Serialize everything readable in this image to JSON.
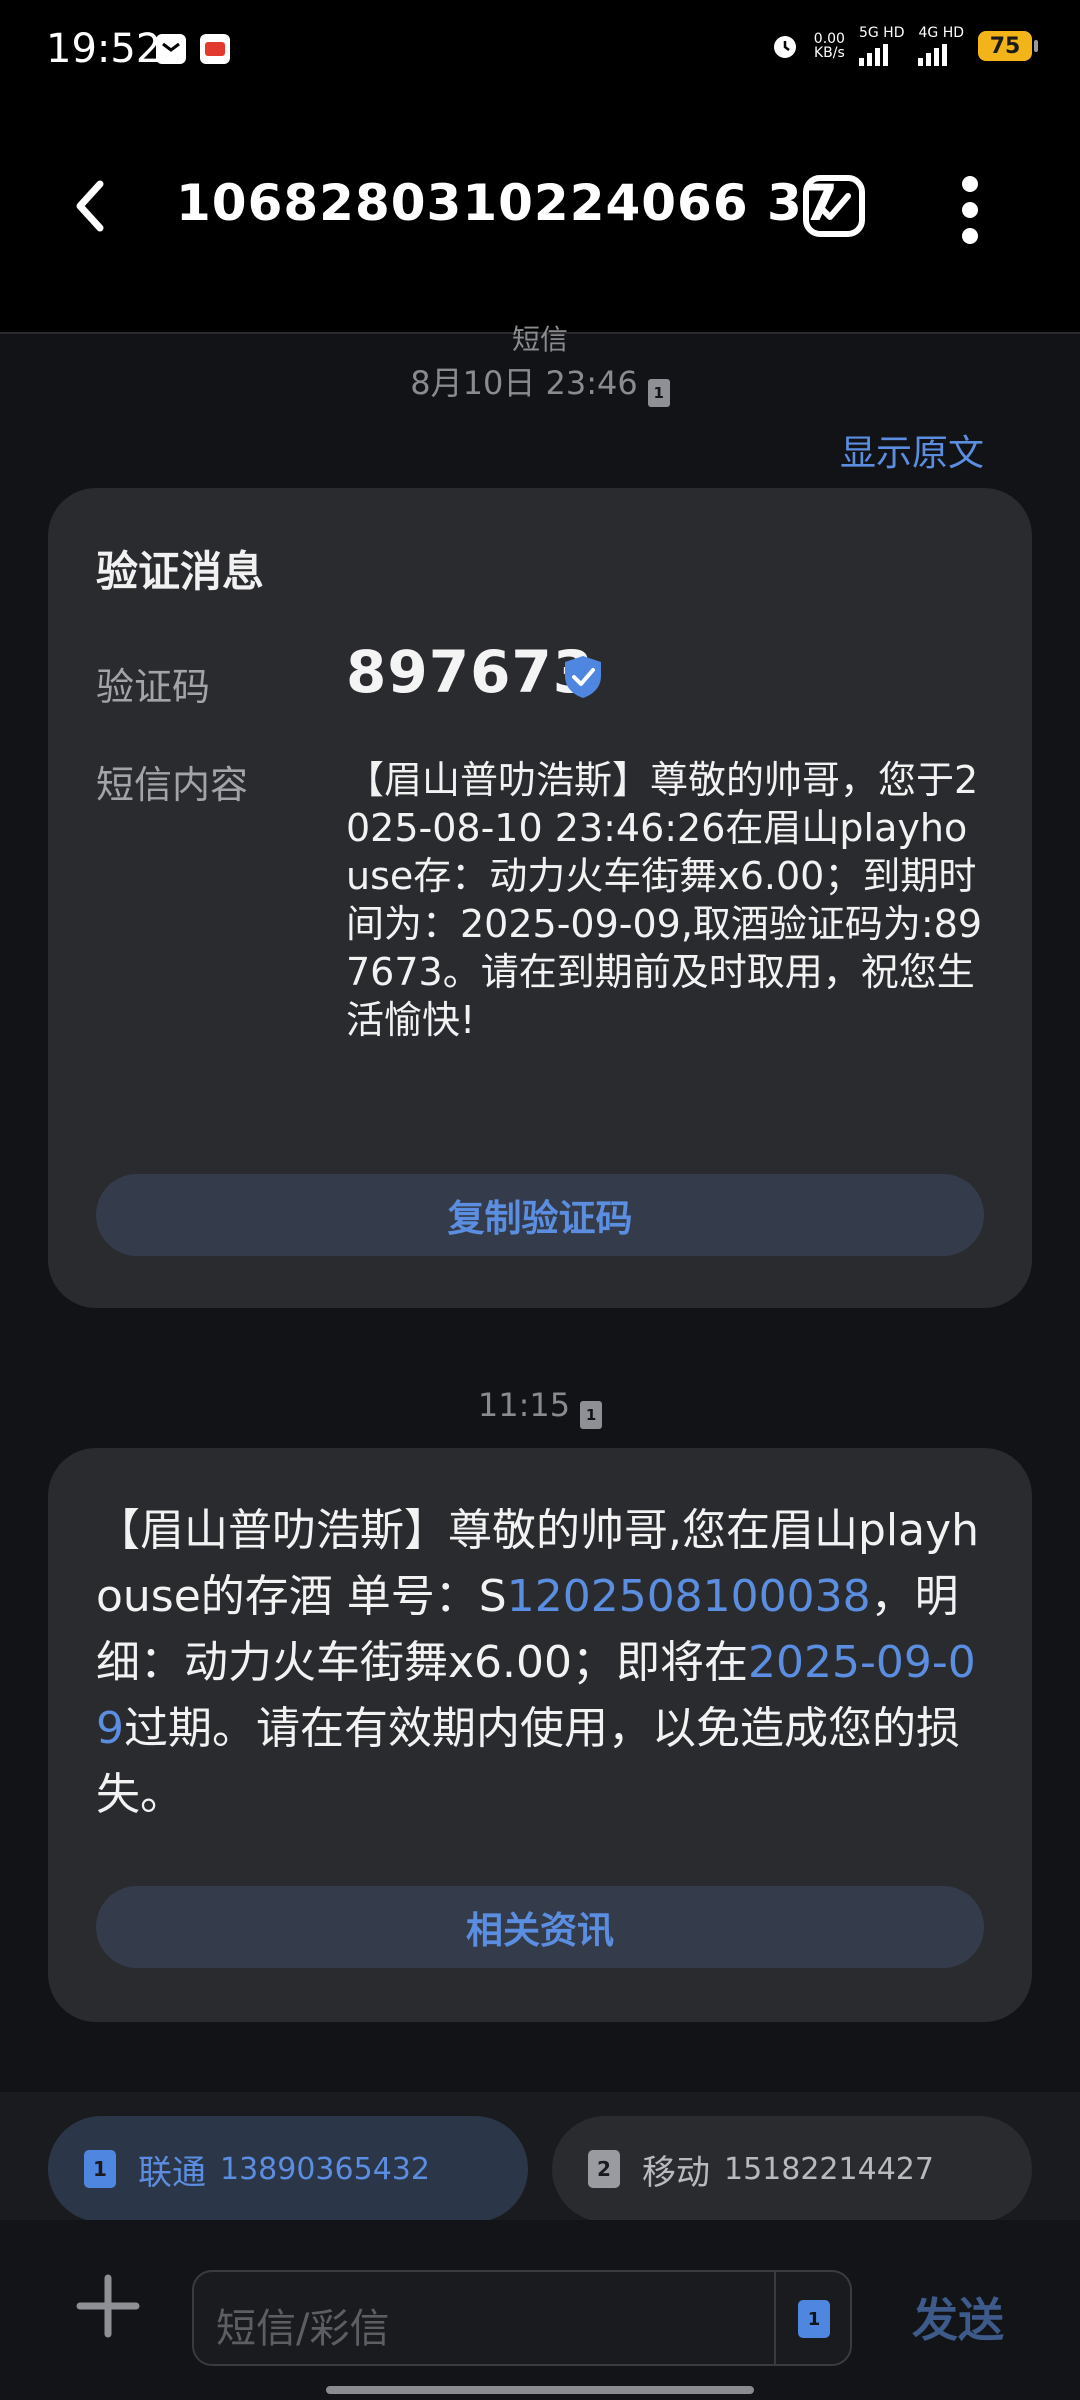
{
  "status_bar": {
    "time": "19:52",
    "net_speed_value": "0.00",
    "net_speed_unit": "KB/s",
    "sim1_net": "5G HD",
    "sim2_net": "4G HD",
    "battery": "75"
  },
  "header": {
    "title": "1068280310224066 37"
  },
  "thread": {
    "source_label": "短信",
    "msg1_time": "8月10日 23:46",
    "show_original": "显示原文",
    "card1": {
      "heading": "验证消息",
      "code_label": "验证码",
      "code": "897673",
      "content_label": "短信内容",
      "content": "【眉山普叻浩斯】尊敬的帅哥，您于2025-08-10 23:46:26在眉山playhouse存：动力火车街舞x6.00；到期时间为：2025-09-09,取酒验证码为:897673。请在到期前及时取用，祝您生活愉快!",
      "button": "复制验证码"
    },
    "msg2_time": "11:15",
    "card2": {
      "text_a": "【眉山普叻浩斯】尊敬的帅哥,您在眉山playhouse的存酒 单号：S",
      "order_no": "1202508100038",
      "text_b": "，明细：动力火车街舞x6.00；即将在",
      "date": "2025-09-09",
      "text_c": "过期。请在有效期内使用，以免造成您的损失。",
      "button": "相关资讯"
    }
  },
  "sim_selector": {
    "sim1": {
      "badge": "1",
      "carrier": "联通",
      "number": "13890365432"
    },
    "sim2": {
      "badge": "2",
      "carrier": "移动",
      "number": "15182214427"
    }
  },
  "composer": {
    "placeholder": "短信/彩信",
    "sim_badge": "1",
    "send": "发送"
  },
  "colors": {
    "accent": "#5b8ee0",
    "card_bg": "#2a2b2e",
    "background": "#121316"
  }
}
